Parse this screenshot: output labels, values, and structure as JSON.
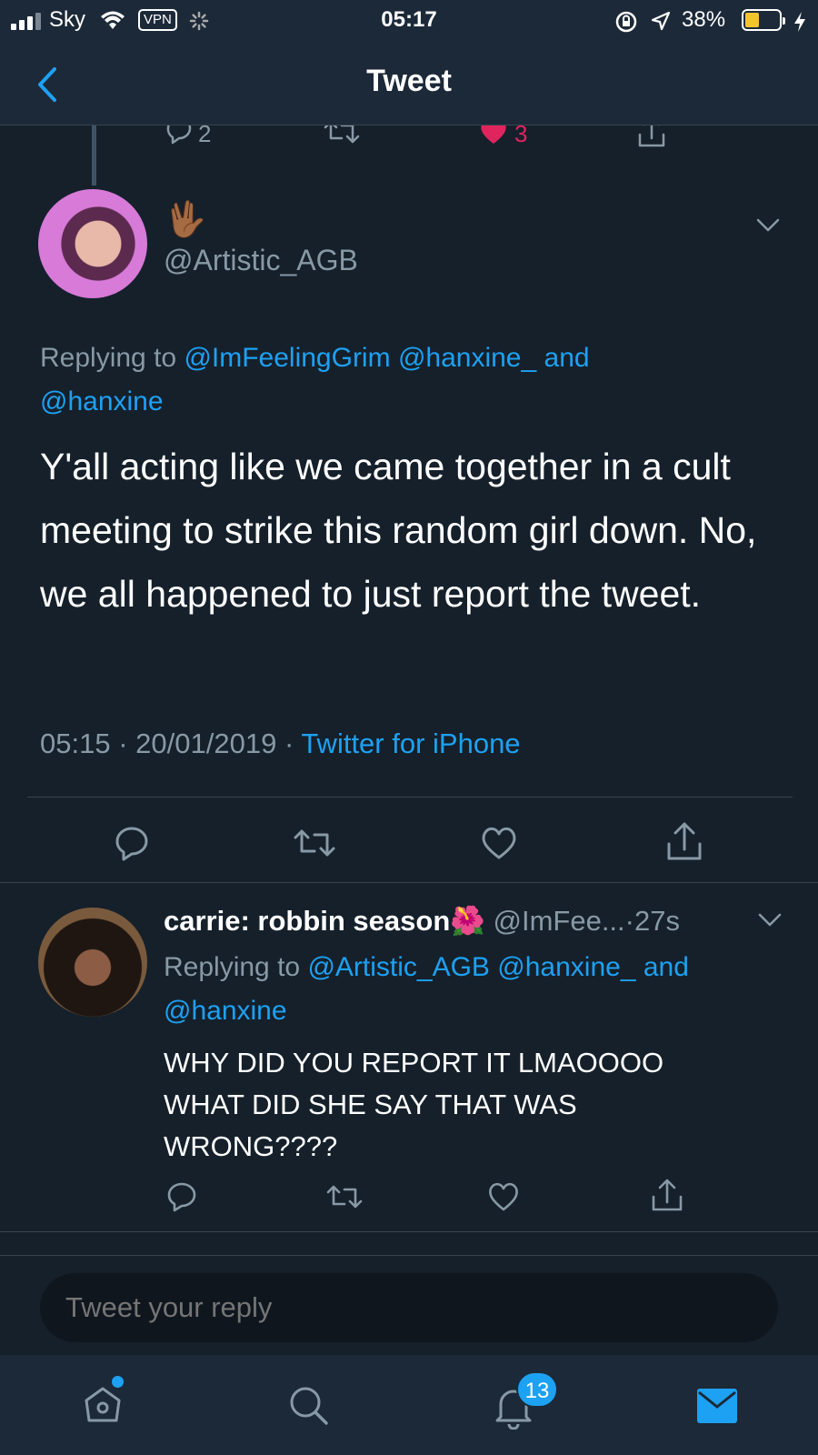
{
  "status_bar": {
    "carrier": "Sky",
    "vpn": "VPN",
    "time": "05:17",
    "battery_percent": "38%",
    "battery_level": 0.38,
    "icons": [
      "signal-icon",
      "wifi-icon",
      "vpn-icon",
      "loading-icon",
      "orientation-lock-icon",
      "location-icon",
      "battery-icon",
      "charging-icon"
    ]
  },
  "header": {
    "title": "Tweet",
    "back_icon": "chevron-left-icon"
  },
  "parent_tweet_actions": {
    "reply_count": "2",
    "like_count": "3",
    "liked_color": "#e0245e"
  },
  "main_tweet": {
    "display_name_emoji": "🖖🏾",
    "handle": "@Artistic_AGB",
    "replying_prefix": "Replying to",
    "replying_to": [
      "@ImFeelingGrim",
      "@hanxine_",
      "and",
      "@hanxine"
    ],
    "text": "Y'all acting like we came together in a cult meeting to strike this random girl down. No, we all happened to just report the tweet.",
    "time": "05:15",
    "sep": "·",
    "date": "20/01/2019",
    "source": "Twitter for iPhone"
  },
  "reply_tweet": {
    "display_name": "carrie: robbin season🌺",
    "handle": "@ImFee...",
    "sep": "·",
    "age": "27s",
    "replying_prefix": "Replying to",
    "replying_to": [
      "@Artistic_AGB",
      "@hanxine_",
      "and",
      "@hanxine"
    ],
    "text_lines": [
      "WHY DID YOU REPORT IT LMAOOOO",
      "WHAT DID SHE SAY THAT WAS",
      "WRONG????"
    ]
  },
  "reply_box": {
    "placeholder": "Tweet your reply"
  },
  "tab_bar": {
    "notifications_badge": "13",
    "accent": "#1da1f2",
    "tabs": [
      "home-icon",
      "search-icon",
      "notifications-icon",
      "messages-icon"
    ]
  }
}
